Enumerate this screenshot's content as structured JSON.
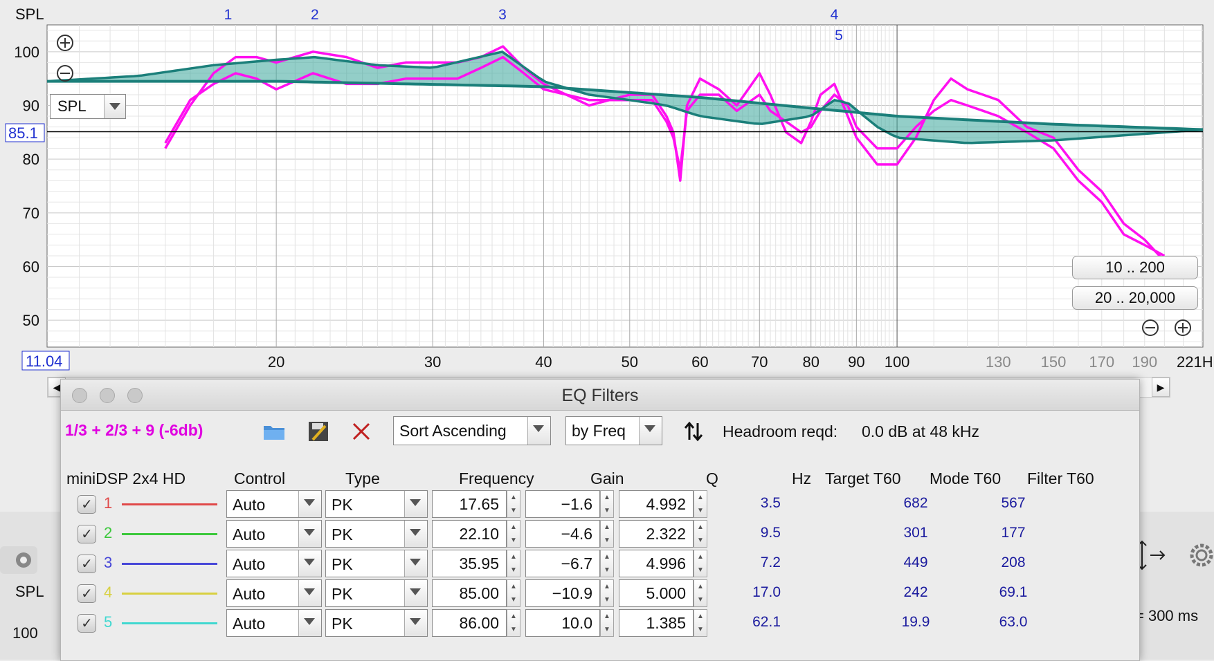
{
  "chart_data": {
    "type": "line",
    "title": "",
    "ylabel": "SPL",
    "xunit_label": "221H",
    "x_scale": "log",
    "xlim": [
      11.04,
      221
    ],
    "ylim": [
      45,
      105
    ],
    "reference_level": 85.1,
    "y_ticks": [
      50,
      60,
      70,
      80,
      90,
      100
    ],
    "x_ticks_major": [
      20,
      30,
      40,
      50,
      60,
      70,
      80,
      90,
      100
    ],
    "x_ticks_minor_labels": [
      130,
      150,
      170,
      190
    ],
    "filter_markers": [
      {
        "label": "1",
        "freq": 17.65
      },
      {
        "label": "2",
        "freq": 22.1
      },
      {
        "label": "3",
        "freq": 35.95
      },
      {
        "label": "4",
        "freq": 85.0
      },
      {
        "label": "5",
        "freq": 86.0
      }
    ],
    "series": [
      {
        "role": "measured",
        "color": "#ff10f0",
        "x": [
          15,
          16,
          17,
          18,
          19,
          20,
          22,
          24,
          26,
          28,
          30,
          32,
          34,
          36,
          38,
          40,
          45,
          50,
          53,
          55,
          56,
          57,
          58,
          60,
          63,
          66,
          70,
          72,
          75,
          78,
          80,
          82,
          85,
          88,
          90,
          95,
          100,
          105,
          110,
          115,
          120,
          125,
          130,
          140,
          150,
          160,
          170,
          180,
          190,
          200
        ],
        "y": [
          82,
          90,
          96,
          99,
          99,
          98,
          100,
          99,
          97,
          98,
          98,
          98,
          99,
          101,
          97,
          94,
          90,
          92,
          92,
          88,
          85,
          76,
          90,
          95,
          93,
          90,
          96,
          92,
          85,
          83,
          87,
          92,
          94,
          88,
          84,
          79,
          79,
          84,
          91,
          95,
          93,
          92,
          91,
          86,
          84,
          78,
          74,
          68,
          65,
          61
        ]
      },
      {
        "role": "measured-second",
        "color": "#ff10f0",
        "x": [
          15,
          16,
          17,
          18,
          19,
          20,
          22,
          24,
          26,
          28,
          30,
          32,
          34,
          36,
          38,
          40,
          45,
          50,
          53,
          55,
          56,
          57,
          58,
          60,
          63,
          66,
          70,
          72,
          75,
          78,
          80,
          82,
          85,
          88,
          90,
          95,
          100,
          105,
          110,
          115,
          120,
          125,
          130,
          140,
          150,
          160,
          170,
          180,
          190,
          200
        ],
        "y": [
          83,
          91,
          94,
          96,
          95,
          93,
          96,
          94,
          94,
          95,
          95,
          95,
          97,
          99,
          96,
          93,
          91,
          91,
          91,
          87,
          84,
          78,
          89,
          92,
          92,
          89,
          92,
          89,
          87,
          85,
          86,
          89,
          92,
          90,
          86,
          82,
          82,
          86,
          89,
          91,
          90,
          89,
          88,
          85,
          82,
          76,
          72,
          66,
          64,
          62
        ]
      },
      {
        "role": "filter-response",
        "color": "#1b7f7a",
        "x": [
          11.04,
          14,
          17,
          20,
          22.1,
          26,
          30,
          35.95,
          40,
          45,
          50,
          55,
          60,
          70,
          80,
          85,
          88,
          95,
          100,
          120,
          150,
          221
        ],
        "y": [
          94.5,
          95.5,
          97.5,
          98.5,
          99,
          97.5,
          97,
          100,
          94.5,
          92,
          91,
          90,
          88,
          86.5,
          88,
          91,
          90.5,
          86,
          84,
          83,
          83.5,
          85.5
        ]
      },
      {
        "role": "target",
        "color": "#1b7f7a",
        "x": [
          11.04,
          20,
          40,
          60,
          80,
          100,
          150,
          221
        ],
        "y": [
          94.5,
          94.5,
          93.5,
          91.5,
          89.5,
          88,
          86.5,
          85.5
        ]
      }
    ]
  },
  "chart_ui": {
    "spl_label": "SPL",
    "spl_combo": "SPL",
    "ref_level_box": "85.1",
    "x_start_box": "11.04",
    "range_btn_1": "10 .. 200",
    "range_btn_2": "20 .. 20,000"
  },
  "eq_window": {
    "title": "EQ Filters",
    "preset_name": "1/3 + 2/3 + 9 (-6db)",
    "sort_select": "Sort Ascending",
    "by_select": "by Freq",
    "headroom_label": "Headroom reqd:",
    "headroom_value": "0.0 dB at 48 kHz",
    "columns": {
      "device": "miniDSP 2x4 HD",
      "control": "Control",
      "type": "Type",
      "frequency": "Frequency",
      "gain": "Gain",
      "q": "Q",
      "hz": "Hz",
      "target_t60": "Target T60",
      "mode_t60": "Mode T60",
      "filter_t60": "Filter T60"
    },
    "filters": [
      {
        "num": "1",
        "color": "#e04848",
        "control": "Auto",
        "type": "PK",
        "frequency": "17.65",
        "gain": "-1.6",
        "q": "4.992",
        "hz": "3.5",
        "mode_t60": "682",
        "filter_t60": "567"
      },
      {
        "num": "2",
        "color": "#3cc83c",
        "control": "Auto",
        "type": "PK",
        "frequency": "22.10",
        "gain": "-4.6",
        "q": "2.322",
        "hz": "9.5",
        "mode_t60": "301",
        "filter_t60": "177"
      },
      {
        "num": "3",
        "color": "#4848d8",
        "control": "Auto",
        "type": "PK",
        "frequency": "35.95",
        "gain": "-6.7",
        "q": "4.996",
        "hz": "7.2",
        "mode_t60": "449",
        "filter_t60": "208"
      },
      {
        "num": "4",
        "color": "#d8d040",
        "control": "Auto",
        "type": "PK",
        "frequency": "85.00",
        "gain": "-10.9",
        "q": "5.000",
        "hz": "17.0",
        "mode_t60": "242",
        "filter_t60": "69.1"
      },
      {
        "num": "5",
        "color": "#40d8d0",
        "control": "Auto",
        "type": "PK",
        "frequency": "86.00",
        "gain": "10.0",
        "q": "1.385",
        "hz": "62.1",
        "mode_t60": "19.9",
        "filter_t60": "63.0"
      }
    ]
  },
  "background": {
    "spl_label": "SPL",
    "y_label": "100",
    "window_text": "= 300 ms"
  }
}
